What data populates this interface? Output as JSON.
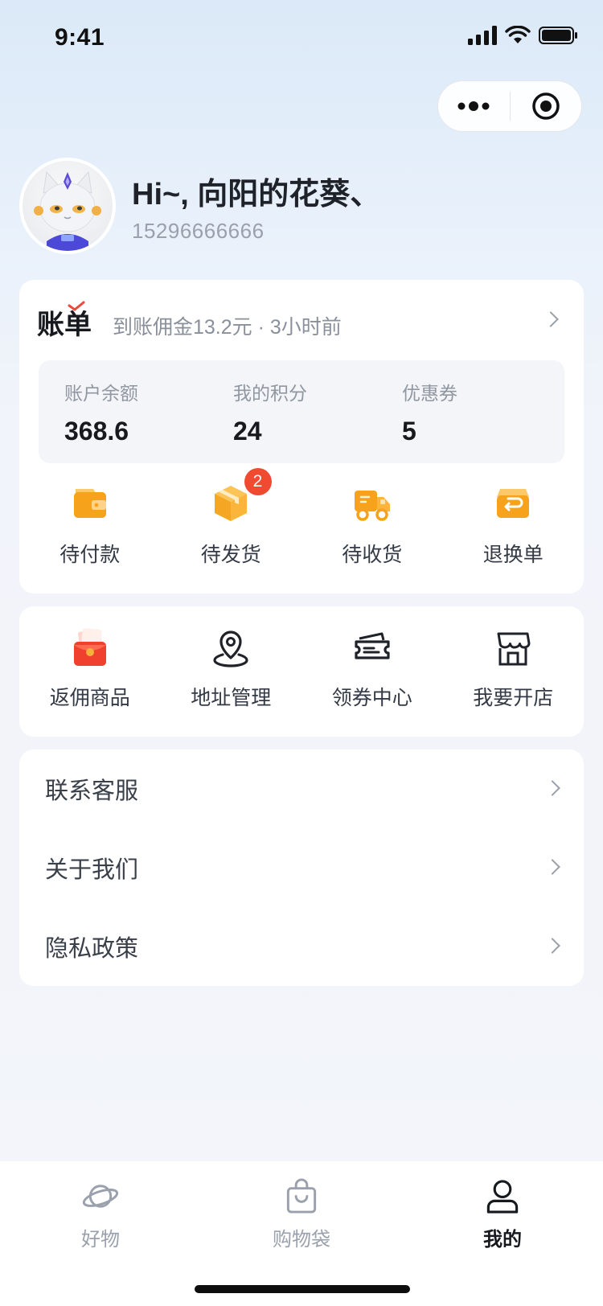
{
  "status_bar": {
    "time": "9:41"
  },
  "profile": {
    "greeting": "Hi~, 向阳的花葵、",
    "phone": "15296666666"
  },
  "bill": {
    "title": "账单",
    "subtitle": "到账佣金13.2元 · 3小时前",
    "stats": [
      {
        "label": "账户余额",
        "value": "368.6"
      },
      {
        "label": "我的积分",
        "value": "24"
      },
      {
        "label": "优惠券",
        "value": "5"
      }
    ],
    "orders": [
      {
        "label": "待付款",
        "icon": "wallet-icon"
      },
      {
        "label": "待发货",
        "icon": "package-icon",
        "badge": "2"
      },
      {
        "label": "待收货",
        "icon": "delivery-truck-icon"
      },
      {
        "label": "退换单",
        "icon": "return-icon"
      }
    ]
  },
  "tools": [
    {
      "label": "返佣商品",
      "icon": "red-packet-icon"
    },
    {
      "label": "地址管理",
      "icon": "location-pin-icon"
    },
    {
      "label": "领券中心",
      "icon": "coupon-ticket-icon"
    },
    {
      "label": "我要开店",
      "icon": "storefront-icon"
    }
  ],
  "menu": [
    {
      "label": "联系客服"
    },
    {
      "label": "关于我们"
    },
    {
      "label": "隐私政策"
    }
  ],
  "tabbar": [
    {
      "label": "好物",
      "icon": "planet-icon",
      "active": false
    },
    {
      "label": "购物袋",
      "icon": "shopping-bag-icon",
      "active": false
    },
    {
      "label": "我的",
      "icon": "user-icon",
      "active": true
    }
  ],
  "colors": {
    "accent_orange": "#F7A21B",
    "badge_red": "#F04A31",
    "text_primary": "#16191E",
    "text_secondary": "#8A909B"
  }
}
